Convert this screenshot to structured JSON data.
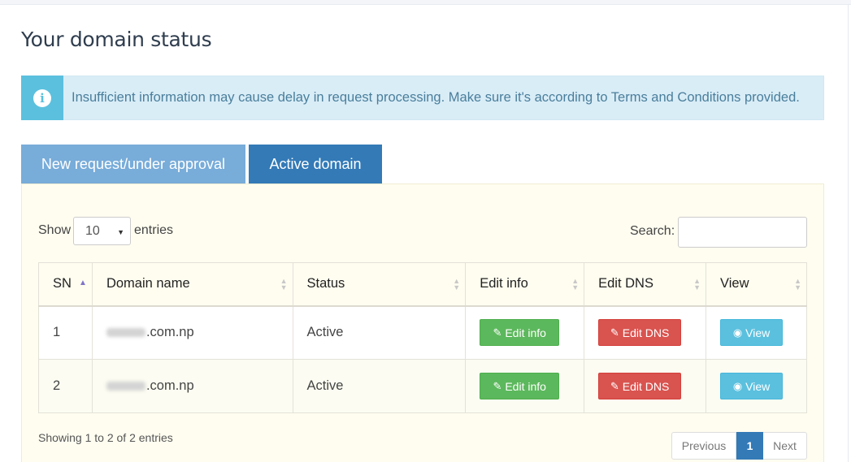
{
  "page": {
    "title": "Your domain status"
  },
  "alert": {
    "icon": "info-circle-icon",
    "text": "Insufficient information may cause delay in request processing. Make sure it's according to Terms and Conditions provided."
  },
  "tabs": [
    {
      "label": "New request/under approval",
      "active": false
    },
    {
      "label": "Active domain",
      "active": true
    }
  ],
  "length_control": {
    "show_label": "Show",
    "value": "10",
    "entries_label": "entries"
  },
  "search": {
    "label": "Search:",
    "value": ""
  },
  "table": {
    "columns": [
      "SN",
      "Domain name",
      "Status",
      "Edit info",
      "Edit DNS",
      "View"
    ],
    "sorted_column": "SN",
    "rows": [
      {
        "sn": "1",
        "domain_suffix": ".com.np",
        "status": "Active",
        "edit_info": "Edit info",
        "edit_dns": "Edit DNS",
        "view": "View"
      },
      {
        "sn": "2",
        "domain_suffix": ".com.np",
        "status": "Active",
        "edit_info": "Edit info",
        "edit_dns": "Edit DNS",
        "view": "View"
      }
    ]
  },
  "footer": {
    "info": "Showing 1 to 2 of 2 entries"
  },
  "pagination": {
    "previous": "Previous",
    "current": "1",
    "next": "Next"
  },
  "colors": {
    "primary": "#337ab7",
    "tab_inactive": "#78acd9",
    "info": "#5bc0de",
    "success": "#5cb85c",
    "danger": "#d9534f",
    "status_active": "#3c763d"
  }
}
